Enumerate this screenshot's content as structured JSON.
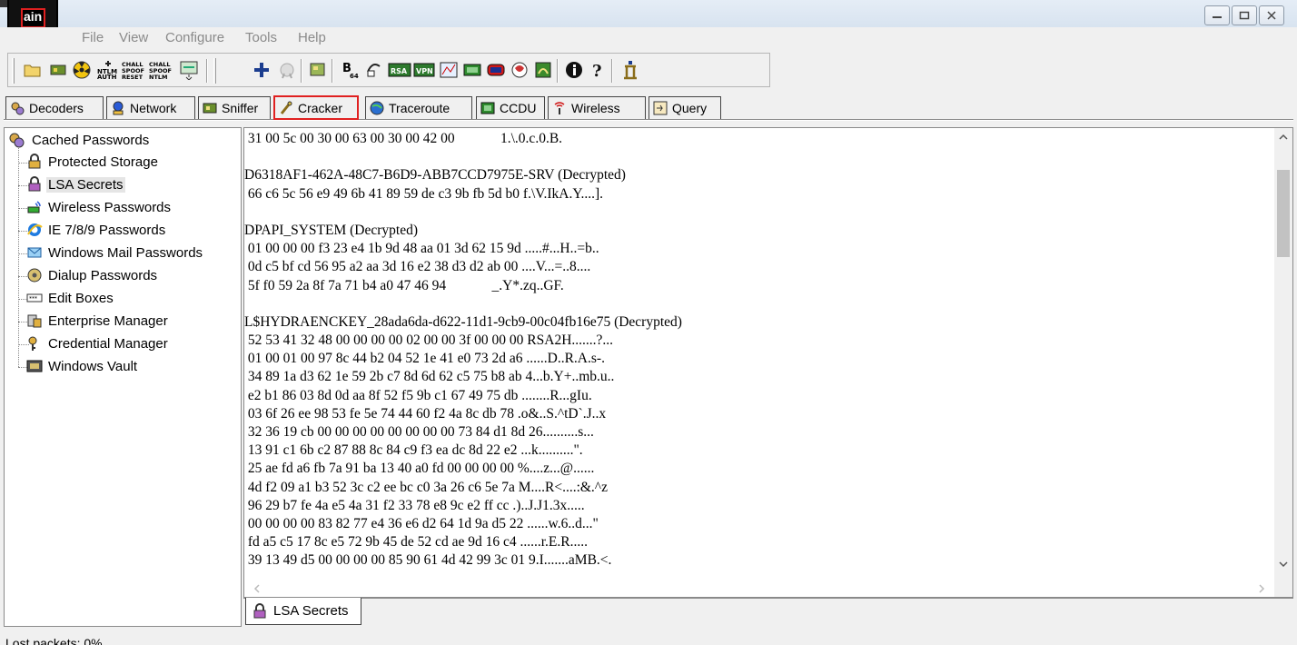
{
  "app": {
    "logo_text": "ain",
    "window_buttons": [
      "minimize-icon",
      "maximize-icon",
      "close-icon"
    ]
  },
  "menu": {
    "items": [
      "File",
      "View",
      "Configure",
      "Tools",
      "Help"
    ]
  },
  "toolbar": {
    "buttons": [
      "open-folder-icon",
      "network-card-icon",
      "radiation-icon",
      "ntlm-auth-icon",
      "chall-spoof-reset-icon",
      "chall-spoof-ntlm-icon",
      "monitor-icon",
      "add-icon",
      "certificate-icon",
      "scan-icon",
      "base64-icon",
      "hash-calculator-icon",
      "rsa-icon",
      "vpn-icon",
      "graph-icon",
      "ccdu-icon",
      "wireless-icon",
      "sniffer-icon",
      "photo-icon",
      "info-icon",
      "help-icon",
      "cracker-icon"
    ]
  },
  "tabs": [
    {
      "label": "Decoders",
      "icon": "decoders-icon"
    },
    {
      "label": "Network",
      "icon": "network-icon"
    },
    {
      "label": "Sniffer",
      "icon": "sniffer-icon"
    },
    {
      "label": "Cracker",
      "icon": "cracker-icon",
      "active": true
    },
    {
      "label": "Traceroute",
      "icon": "traceroute-icon"
    },
    {
      "label": "CCDU",
      "icon": "ccdu-icon"
    },
    {
      "label": "Wireless",
      "icon": "wireless-icon"
    },
    {
      "label": "Query",
      "icon": "query-icon"
    }
  ],
  "tree": {
    "root": "Cached Passwords",
    "items": [
      {
        "label": "Protected Storage",
        "icon": "protected-storage-icon"
      },
      {
        "label": "LSA Secrets",
        "icon": "lsa-secrets-icon",
        "selected": true
      },
      {
        "label": "Wireless Passwords",
        "icon": "wireless-passwords-icon"
      },
      {
        "label": "IE 7/8/9 Passwords",
        "icon": "ie-icon"
      },
      {
        "label": "Windows Mail Passwords",
        "icon": "mail-icon"
      },
      {
        "label": "Dialup Passwords",
        "icon": "dialup-icon"
      },
      {
        "label": "Edit Boxes",
        "icon": "edit-box-icon"
      },
      {
        "label": "Enterprise Manager",
        "icon": "enterprise-manager-icon"
      },
      {
        "label": "Credential Manager",
        "icon": "credential-manager-icon"
      },
      {
        "label": "Windows Vault",
        "icon": "vault-icon"
      }
    ]
  },
  "content": {
    "lines": [
      " 31 00 5c 00 30 00 63 00 30 00 42 00             1.\\.0.c.0.B.",
      "",
      "D6318AF1-462A-48C7-B6D9-ABB7CCD7975E-SRV (Decrypted)",
      " 66 c6 5c 56 e9 49 6b 41 89 59 de c3 9b fb 5d b0 f.\\V.IkA.Y....].",
      "",
      "DPAPI_SYSTEM (Decrypted)",
      " 01 00 00 00 f3 23 e4 1b 9d 48 aa 01 3d 62 15 9d .....#...H..=b..",
      " 0d c5 bf cd 56 95 a2 aa 3d 16 e2 38 d3 d2 ab 00 ....V...=..8....",
      " 5f f0 59 2a 8f 7a 71 b4 a0 47 46 94             _.Y*.zq..GF.",
      "",
      "L$HYDRAENCKEY_28ada6da-d622-11d1-9cb9-00c04fb16e75 (Decrypted)",
      " 52 53 41 32 48 00 00 00 00 02 00 00 3f 00 00 00 RSA2H.......?...",
      " 01 00 01 00 97 8c 44 b2 04 52 1e 41 e0 73 2d a6 ......D..R.A.s-.",
      " 34 89 1a d3 62 1e 59 2b c7 8d 6d 62 c5 75 b8 ab 4...b.Y+..mb.u..",
      " e2 b1 86 03 8d 0d aa 8f 52 f5 9b c1 67 49 75 db ........R...gIu.",
      " 03 6f 26 ee 98 53 fe 5e 74 44 60 f2 4a 8c db 78 .o&..S.^tD`.J..x",
      " 32 36 19 cb 00 00 00 00 00 00 00 00 73 84 d1 8d 26..........s...",
      " 13 91 c1 6b c2 87 88 8c 84 c9 f3 ea dc 8d 22 e2 ...k..........\".",
      " 25 ae fd a6 fb 7a 91 ba 13 40 a0 fd 00 00 00 00 %....z...@......",
      " 4d f2 09 a1 b3 52 3c c2 ee bc c0 3a 26 c6 5e 7a M....R<....:&.^z",
      " 96 29 b7 fe 4a e5 4a 31 f2 33 78 e8 9c e2 ff cc .)..J.J1.3x.....",
      " 00 00 00 00 83 82 77 e4 36 e6 d2 64 1d 9a d5 22 ......w.6..d...\"",
      " fd a5 c5 17 8c e5 72 9b 45 de 52 cd ae 9d 16 c4 ......r.E.R.....",
      " 39 13 49 d5 00 00 00 00 85 90 61 4d 42 99 3c 01 9.I.......aMB.<."
    ]
  },
  "bottom_tab": {
    "label": "LSA Secrets",
    "icon": "lsa-secrets-icon"
  },
  "status": {
    "text": "Lost packets:  0%"
  },
  "colors": {
    "accent": "#e02020",
    "selection": "#e5e5e5"
  }
}
